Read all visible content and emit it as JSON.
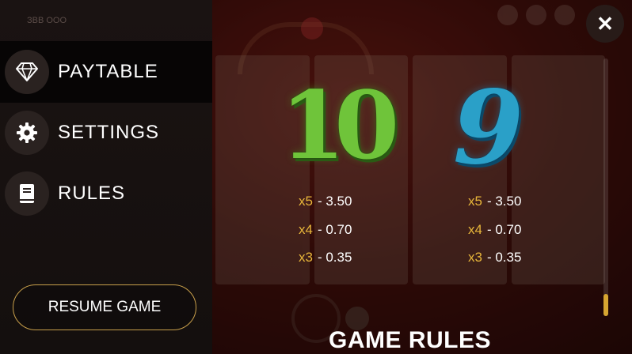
{
  "sidebar": {
    "top_label": "ЗВВ ООО",
    "items": [
      {
        "label": "PAYTABLE",
        "icon": "diamond-icon"
      },
      {
        "label": "SETTINGS",
        "icon": "gear-icon"
      },
      {
        "label": "RULES",
        "icon": "book-icon"
      }
    ],
    "resume_label": "RESUME GAME"
  },
  "close_label": "✕",
  "paytable": {
    "symbols": [
      {
        "glyph": "10",
        "rows": [
          {
            "mult": "x5",
            "value": "- 3.50"
          },
          {
            "mult": "x4",
            "value": "- 0.70"
          },
          {
            "mult": "x3",
            "value": "- 0.35"
          }
        ]
      },
      {
        "glyph": "9",
        "rows": [
          {
            "mult": "x5",
            "value": "- 3.50"
          },
          {
            "mult": "x4",
            "value": "- 0.70"
          },
          {
            "mult": "x3",
            "value": "- 0.35"
          }
        ]
      }
    ]
  },
  "section_heading": "GAME RULES",
  "colors": {
    "accent_gold": "#e8b63a",
    "symbol_10": "#6fc43a",
    "symbol_9": "#2aa0c8"
  }
}
